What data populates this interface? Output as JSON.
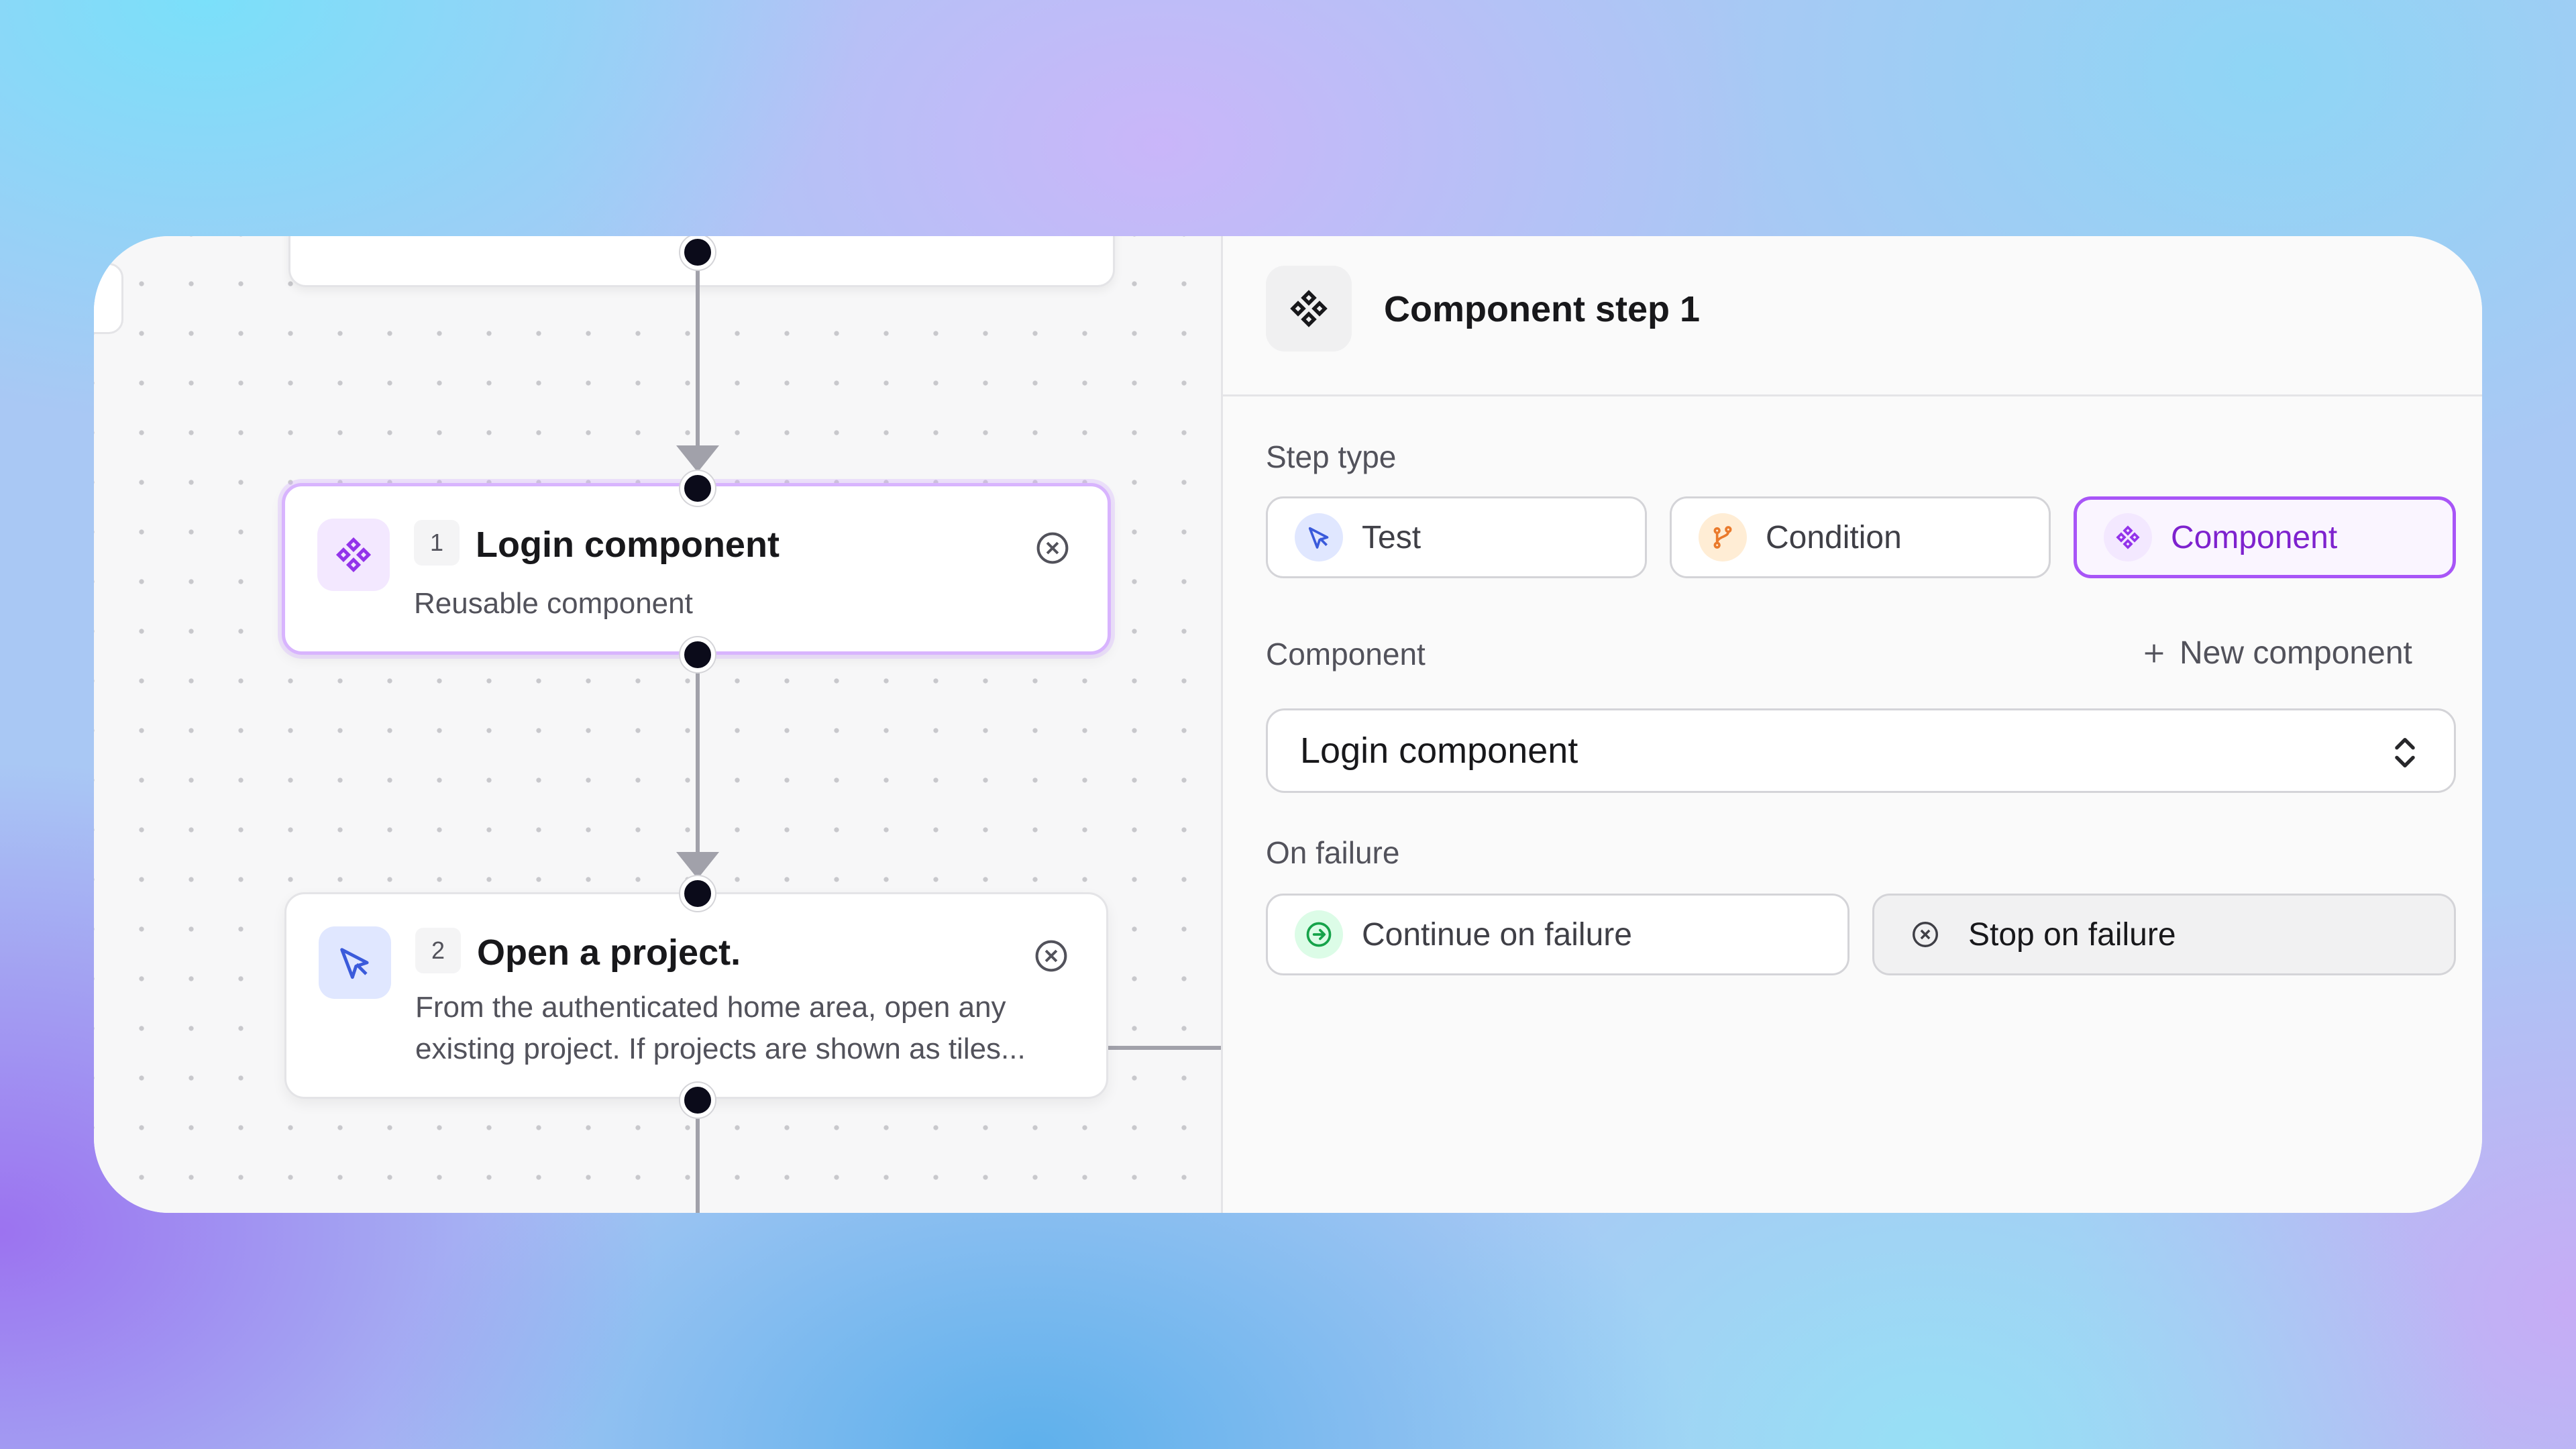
{
  "canvas": {
    "nodes": [
      {
        "number": "1",
        "title": "Login component",
        "description": "Reusable component",
        "icon": "component-icon",
        "selected": true
      },
      {
        "number": "2",
        "title": "Open a project.",
        "description": "From the authenticated home area, open any existing project. If projects are shown as tiles...",
        "icon": "cursor-click-icon",
        "selected": false
      }
    ]
  },
  "panel": {
    "title": "Component step 1",
    "title_icon": "component-icon",
    "step_type": {
      "label": "Step type",
      "options": [
        {
          "label": "Test",
          "icon": "cursor-click-icon",
          "active": false
        },
        {
          "label": "Condition",
          "icon": "branch-icon",
          "active": false
        },
        {
          "label": "Component",
          "icon": "component-icon",
          "active": true
        }
      ]
    },
    "component": {
      "label": "Component",
      "new_label": "New component",
      "selected_value": "Login component"
    },
    "on_failure": {
      "label": "On failure",
      "options": [
        {
          "label": "Continue on failure",
          "icon": "arrow-circle-right-icon",
          "active": false
        },
        {
          "label": "Stop on failure",
          "icon": "x-circle-icon",
          "active": true
        }
      ]
    }
  },
  "colors": {
    "accent_purple": "#a855f7",
    "accent_blue": "#3b5bdb",
    "condition_orange": "#ea7a2c",
    "success_green": "#16a34a",
    "connector_gray": "#a1a1aa"
  }
}
